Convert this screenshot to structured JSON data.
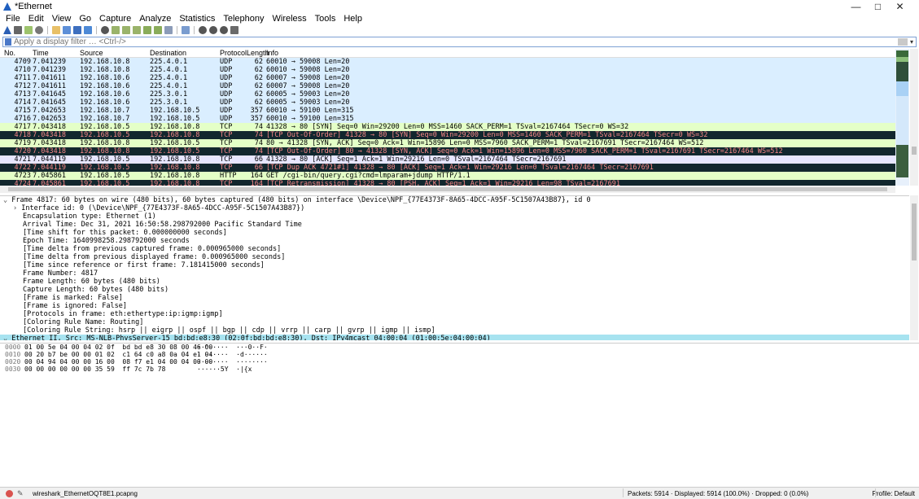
{
  "window": {
    "title": "*Ethernet",
    "min": "—",
    "max": "□",
    "close": "✕"
  },
  "menu": [
    "File",
    "Edit",
    "View",
    "Go",
    "Capture",
    "Analyze",
    "Statistics",
    "Telephony",
    "Wireless",
    "Tools",
    "Help"
  ],
  "filter": {
    "placeholder": "Apply a display filter … <Ctrl-/>",
    "value": ""
  },
  "columns": {
    "no": "No.",
    "time": "Time",
    "source": "Source",
    "destination": "Destination",
    "protocol": "Protocol",
    "length": "Length",
    "info": "Info"
  },
  "colors": {
    "udp": "#daeeff",
    "tcp": "#e7e6ff",
    "tcp_ok": "#e4ffc7",
    "bad": "#12272e",
    "bad_fg": "#f78787",
    "http": "#e4ffc7",
    "selected_detail": "#a7e3f0"
  },
  "packets": [
    {
      "no": "4709",
      "time": "7.041239",
      "src": "192.168.10.8",
      "dst": "225.4.0.1",
      "proto": "UDP",
      "len": "62",
      "info": "60010 → 59008 Len=20",
      "style": "udp"
    },
    {
      "no": "4710",
      "time": "7.041239",
      "src": "192.168.10.8",
      "dst": "225.4.0.1",
      "proto": "UDP",
      "len": "62",
      "info": "60010 → 59008 Len=20",
      "style": "udp"
    },
    {
      "no": "4711",
      "time": "7.041611",
      "src": "192.168.10.6",
      "dst": "225.4.0.1",
      "proto": "UDP",
      "len": "62",
      "info": "60007 → 59008 Len=20",
      "style": "udp"
    },
    {
      "no": "4712",
      "time": "7.041611",
      "src": "192.168.10.6",
      "dst": "225.4.0.1",
      "proto": "UDP",
      "len": "62",
      "info": "60007 → 59008 Len=20",
      "style": "udp"
    },
    {
      "no": "4713",
      "time": "7.041645",
      "src": "192.168.10.6",
      "dst": "225.3.0.1",
      "proto": "UDP",
      "len": "62",
      "info": "60005 → 59003 Len=20",
      "style": "udp"
    },
    {
      "no": "4714",
      "time": "7.041645",
      "src": "192.168.10.6",
      "dst": "225.3.0.1",
      "proto": "UDP",
      "len": "62",
      "info": "60005 → 59003 Len=20",
      "style": "udp"
    },
    {
      "no": "4715",
      "time": "7.042653",
      "src": "192.168.10.7",
      "dst": "192.168.10.5",
      "proto": "UDP",
      "len": "357",
      "info": "60010 → 59100 Len=315",
      "style": "udp"
    },
    {
      "no": "4716",
      "time": "7.042653",
      "src": "192.168.10.7",
      "dst": "192.168.10.5",
      "proto": "UDP",
      "len": "357",
      "info": "60010 → 59100 Len=315",
      "style": "udp"
    },
    {
      "no": "4717",
      "time": "7.043418",
      "src": "192.168.10.5",
      "dst": "192.168.10.8",
      "proto": "TCP",
      "len": "74",
      "info": "41328 → 80 [SYN] Seq=0 Win=29200 Len=0 MSS=1460 SACK_PERM=1 TSval=2167464 TSecr=0 WS=32",
      "style": "tcp_ok"
    },
    {
      "no": "4718",
      "time": "7.043418",
      "src": "192.168.10.5",
      "dst": "192.168.10.8",
      "proto": "TCP",
      "len": "74",
      "info": "[TCP Out-Of-Order] 41328 → 80 [SYN] Seq=0 Win=29200 Len=0 MSS=1460 SACK_PERM=1 TSval=2167464 TSecr=0 WS=32",
      "style": "bad"
    },
    {
      "no": "4719",
      "time": "7.043418",
      "src": "192.168.10.8",
      "dst": "192.168.10.5",
      "proto": "TCP",
      "len": "74",
      "info": "80 → 41328 [SYN, ACK] Seq=0 Ack=1 Win=15896 Len=0 MSS=7960 SACK_PERM=1 TSval=2167691 TSecr=2167464 WS=512",
      "style": "tcp_ok"
    },
    {
      "no": "4720",
      "time": "7.043418",
      "src": "192.168.10.8",
      "dst": "192.168.10.5",
      "proto": "TCP",
      "len": "74",
      "info": "[TCP Out-Of-Order] 80 → 41328 [SYN, ACK] Seq=0 Ack=1 Win=15896 Len=0 MSS=7960 SACK_PERM=1 TSval=2167691 TSecr=2167464 WS=512",
      "style": "bad"
    },
    {
      "no": "4721",
      "time": "7.044119",
      "src": "192.168.10.5",
      "dst": "192.168.10.8",
      "proto": "TCP",
      "len": "66",
      "info": "41328 → 80 [ACK] Seq=1 Ack=1 Win=29216 Len=0 TSval=2167464 TSecr=2167691",
      "style": "tcp"
    },
    {
      "no": "4722",
      "time": "7.044119",
      "src": "192.168.10.5",
      "dst": "192.168.10.8",
      "proto": "TCP",
      "len": "66",
      "info": "[TCP Dup ACK 4721#1] 41328 → 80 [ACK] Seq=1 Ack=1 Win=29216 Len=0 TSval=2167464 TSecr=2167691",
      "style": "bad"
    },
    {
      "no": "4723",
      "time": "7.045861",
      "src": "192.168.10.5",
      "dst": "192.168.10.8",
      "proto": "HTTP",
      "len": "164",
      "info": "GET /cgi-bin/query.cgi?cmd=lmparam+jdump HTTP/1.1",
      "style": "http"
    },
    {
      "no": "4724",
      "time": "7.045861",
      "src": "192.168.10.5",
      "dst": "192.168.10.8",
      "proto": "TCP",
      "len": "164",
      "info": "[TCP Retransmission] 41328 → 80 [PSH, ACK] Seq=1 Ack=1 Win=29216 Len=98 TSval=2167691",
      "style": "bad"
    }
  ],
  "details": [
    {
      "text": "Frame 4817: 60 bytes on wire (480 bits), 60 bytes captured (480 bits) on interface \\Device\\NPF_{77E4373F-8A65-4DCC-A95F-5C1507A43B87}, id 0",
      "indent": 0,
      "arrow": "⌄"
    },
    {
      "text": "Interface id: 0 (\\Device\\NPF_{77E4373F-8A65-4DCC-A95F-5C1507A43B87})",
      "indent": 1,
      "arrow": "›"
    },
    {
      "text": "Encapsulation type: Ethernet (1)",
      "indent": 2,
      "arrow": ""
    },
    {
      "text": "Arrival Time: Dec 31, 2021 16:50:58.298792000 Pacific Standard Time",
      "indent": 2,
      "arrow": ""
    },
    {
      "text": "[Time shift for this packet: 0.000000000 seconds]",
      "indent": 2,
      "arrow": ""
    },
    {
      "text": "Epoch Time: 1640998258.298792000 seconds",
      "indent": 2,
      "arrow": ""
    },
    {
      "text": "[Time delta from previous captured frame: 0.000965000 seconds]",
      "indent": 2,
      "arrow": ""
    },
    {
      "text": "[Time delta from previous displayed frame: 0.000965000 seconds]",
      "indent": 2,
      "arrow": ""
    },
    {
      "text": "[Time since reference or first frame: 7.181415000 seconds]",
      "indent": 2,
      "arrow": ""
    },
    {
      "text": "Frame Number: 4817",
      "indent": 2,
      "arrow": ""
    },
    {
      "text": "Frame Length: 60 bytes (480 bits)",
      "indent": 2,
      "arrow": ""
    },
    {
      "text": "Capture Length: 60 bytes (480 bits)",
      "indent": 2,
      "arrow": ""
    },
    {
      "text": "[Frame is marked: False]",
      "indent": 2,
      "arrow": ""
    },
    {
      "text": "[Frame is ignored: False]",
      "indent": 2,
      "arrow": ""
    },
    {
      "text": "[Protocols in frame: eth:ethertype:ip:igmp:igmp]",
      "indent": 2,
      "arrow": ""
    },
    {
      "text": "[Coloring Rule Name: Routing]",
      "indent": 2,
      "arrow": ""
    },
    {
      "text": "[Coloring Rule String: hsrp || eigrp || ospf || bgp || cdp || vrrp || carp || gvrp || igmp || ismp]",
      "indent": 2,
      "arrow": ""
    },
    {
      "text": "Ethernet II, Src: MS-NLB-PhysServer-15_bd:bd:e8:30 (02:0f:bd:bd:e8:30), Dst: IPv4mcast_04:00:04 (01:00:5e:04:00:04)",
      "indent": 0,
      "arrow": "⌄",
      "selected": true
    }
  ],
  "bytes": [
    {
      "off": "0000",
      "hex": "01 00 5e 04 00 04 02 0f  bd bd e8 30 08 00 46 00",
      "ascii": "··^·····  ···0··F·"
    },
    {
      "off": "0010",
      "hex": "00 20 b7 be 00 00 01 02  c1 64 c0 a8 0a 04 e1 04",
      "ascii": "· ······  ·d······"
    },
    {
      "off": "0020",
      "hex": "00 04 94 04 00 00 16 00  08 f7 e1 04 00 04 00 00",
      "ascii": "········  ········"
    },
    {
      "off": "0030",
      "hex": "00 00 00 00 00 00 35 59  ff 7c 7b 78",
      "ascii": "······5Y  ·|{x"
    }
  ],
  "status": {
    "file": "wireshark_EthernetOQT8E1.pcapng",
    "packets": "Packets: 5914 · Displayed: 5914 (100.0%) · Dropped: 0 (0.0%)",
    "profile": "Profile: Default"
  }
}
